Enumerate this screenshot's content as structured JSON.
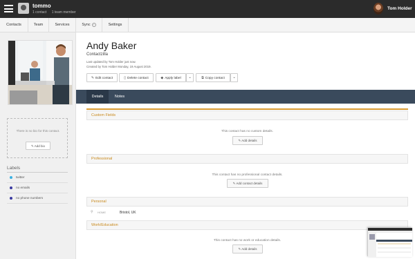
{
  "account": {
    "name": "tommo",
    "contacts": "1 contact",
    "members": "1 team member"
  },
  "user": {
    "name": "Tom Holder"
  },
  "nav": [
    "Contacts",
    "Team",
    "Services",
    "Sync",
    "Settings"
  ],
  "sidebar": {
    "bio_text": "There is no bio for this contact.",
    "add_bio": "Add bio",
    "labels_title": "Labels",
    "labels": [
      {
        "name": "twitter",
        "color": "#3ab0e2"
      },
      {
        "name": "no emails",
        "color": "#3a3aa0"
      },
      {
        "name": "no phone numbers",
        "color": "#3a3aa0"
      }
    ]
  },
  "contact": {
    "name": "Andy Baker",
    "company": "Contactzilla",
    "updated": "Last updated by Tom Holder just now.",
    "created": "Created by Tom Holder Monday, 19 August 2019."
  },
  "actions": {
    "edit": "Edit contact",
    "delete": "Delete contact",
    "apply_label": "Apply label",
    "copy": "Copy contact"
  },
  "tabs": [
    "Details",
    "Notes"
  ],
  "sections": {
    "custom": {
      "title": "Custom Fields",
      "msg": "This contact has no custom details.",
      "btn": "Add details"
    },
    "professional": {
      "title": "Professional",
      "msg": "This contact has no professional contact details.",
      "btn": "Add contact details"
    },
    "personal": {
      "title": "Personal",
      "addr_type": "HOME",
      "addr_value": "Bristol, UK"
    },
    "work": {
      "title": "Work/Education",
      "msg": "This contact has no work or education details.",
      "btn": "Add details"
    }
  },
  "colors": {
    "topbar": "#2b2b2b",
    "tabs": "#3a4a5c",
    "accent": "#c8891c"
  }
}
